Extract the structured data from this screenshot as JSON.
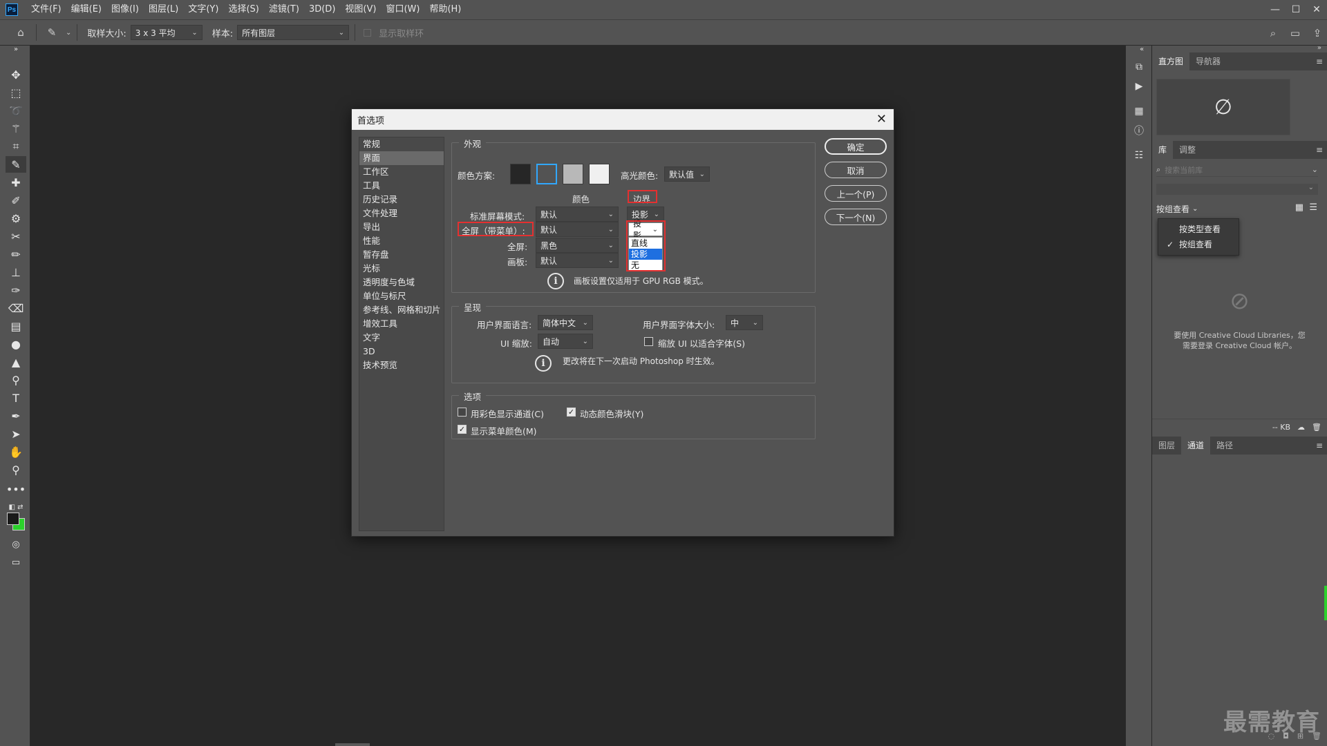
{
  "menubar": {
    "logo": "Ps",
    "items": [
      "文件(F)",
      "编辑(E)",
      "图像(I)",
      "图层(L)",
      "文字(Y)",
      "选择(S)",
      "滤镜(T)",
      "3D(D)",
      "视图(V)",
      "窗口(W)",
      "帮助(H)"
    ],
    "win_minimize": "—",
    "win_maximize": "☐",
    "win_close": "✕"
  },
  "options": {
    "sample_size_label": "取样大小:",
    "sample_size_value": "3 x 3 平均",
    "sample_label": "样本:",
    "sample_value": "所有图层",
    "show_ring_label": "显示取样环"
  },
  "dialog": {
    "title": "首选项",
    "nav": [
      "常规",
      "界面",
      "工作区",
      "工具",
      "历史记录",
      "文件处理",
      "导出",
      "性能",
      "暂存盘",
      "光标",
      "透明度与色域",
      "单位与标尺",
      "参考线、网格和切片",
      "增效工具",
      "文字",
      "3D",
      "技术预览"
    ],
    "active_nav": "界面",
    "appearance": {
      "title": "外观",
      "color_scheme_label": "颜色方案:",
      "swatch_colors": [
        "#262626",
        "#535353",
        "#b8b8b8",
        "#f0f0f0"
      ],
      "highlight_label": "高光颜色:",
      "highlight_value": "默认值",
      "col_color": "颜色",
      "col_border": "边界",
      "rows": [
        {
          "label": "标准屏幕模式:",
          "color": "默认",
          "border": "投影"
        },
        {
          "label": "全屏（带菜单）:",
          "color": "默认",
          "border": "投影"
        },
        {
          "label": "全屏:",
          "color": "黑色",
          "border": ""
        },
        {
          "label": "画板:",
          "color": "默认",
          "border": ""
        }
      ],
      "border_options": [
        "直线",
        "投影",
        "无"
      ],
      "border_selected": "投影",
      "info_note": "画板设置仅适用于 GPU RGB 模式。"
    },
    "presentation": {
      "title": "呈现",
      "ui_language_label": "用户界面语言:",
      "ui_language_value": "简体中文",
      "ui_font_size_label": "用户界面字体大小:",
      "ui_font_size_value": "中",
      "ui_scale_label": "UI 缩放:",
      "ui_scale_value": "自动",
      "scale_to_font_label": "缩放 UI 以适合字体(S)",
      "restart_note": "更改将在下一次启动 Photoshop 时生效。"
    },
    "options": {
      "title": "选项",
      "color_channels_label": "用彩色显示通道(C)",
      "dynamic_sliders_label": "动态颜色滑块(Y)",
      "menu_colors_label": "显示菜单颜色(M)"
    },
    "buttons": {
      "ok": "确定",
      "cancel": "取消",
      "prev": "上一个(P)",
      "next": "下一个(N)"
    },
    "accent_red": "#e53030",
    "selected_blue": "#1e6fe0"
  },
  "panels": {
    "top_tabs": [
      "直方图",
      "导航器"
    ],
    "lib_tabs": [
      "库",
      "调整"
    ],
    "lib_search_placeholder": "搜索当前库",
    "view_by_label": "按组查看",
    "view_menu": [
      "按类型查看",
      "按组查看"
    ],
    "view_menu_checked": "按组查看",
    "cc_message_1": "要使用 Creative Cloud Libraries，您",
    "cc_message_2": "需要登录 Creative Cloud 帐户。",
    "kb_label": "-- KB",
    "bottom_tabs": [
      "图层",
      "通道",
      "路径"
    ],
    "bottom_active": "通道"
  },
  "watermark": "最需教育"
}
